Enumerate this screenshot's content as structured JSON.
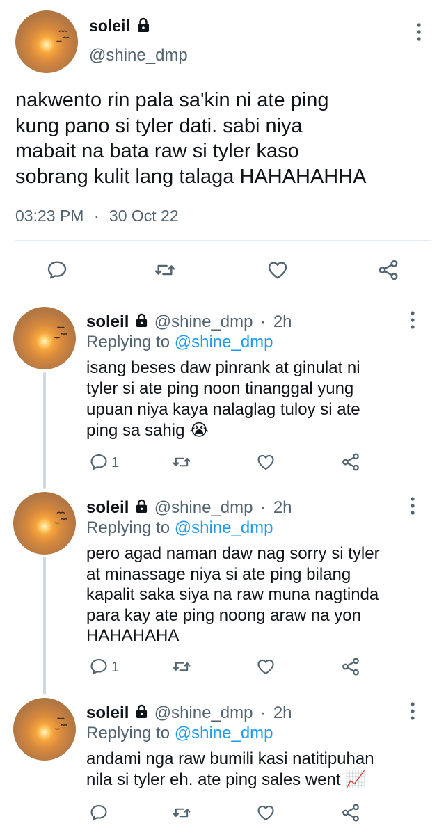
{
  "main_tweet": {
    "display_name": "soleil",
    "handle": "@shine_dmp",
    "text_lines": [
      "nakwento rin pala sa'kin ni ate ping",
      "kung pano si tyler dati. sabi niya",
      "mabait na bata raw si tyler kaso",
      "sobrang kulit lang talaga HAHAHAHHA"
    ],
    "time": "03:23 PM",
    "separator": "·",
    "date": "30 Oct 22"
  },
  "replies": [
    {
      "display_name": "soleil",
      "handle": "@shine_dmp",
      "dot": "·",
      "age": "2h",
      "replying_prefix": "Replying to",
      "replying_handle": "@shine_dmp",
      "text_lines": [
        "isang beses daw pinrank at ginulat ni",
        "tyler si ate ping noon tinanggal yung",
        "upuan niya kaya nalaglag tuloy si ate",
        "ping sa sahig 😭"
      ],
      "reply_count": "1"
    },
    {
      "display_name": "soleil",
      "handle": "@shine_dmp",
      "dot": "·",
      "age": "2h",
      "replying_prefix": "Replying to",
      "replying_handle": "@shine_dmp",
      "text_lines": [
        "pero agad naman daw nag sorry si tyler",
        "at minassage niya si ate ping bilang",
        "kapalit saka siya na raw muna nagtinda",
        "para kay ate ping noong araw na yon",
        "HAHAHAHA"
      ],
      "reply_count": "1"
    },
    {
      "display_name": "soleil",
      "handle": "@shine_dmp",
      "dot": "·",
      "age": "2h",
      "replying_prefix": "Replying to",
      "replying_handle": "@shine_dmp",
      "text_lines": [
        "andami nga raw bumili kasi natitipuhan",
        "nila si tyler eh. ate ping sales went 📈"
      ],
      "reply_count": ""
    }
  ],
  "icons": {
    "reply": "comment-icon",
    "retweet": "retweet-icon",
    "like": "heart-icon",
    "share": "share-icon",
    "more": "more-vertical-icon",
    "lock": "lock-icon"
  },
  "colors": {
    "text": "#0f1419",
    "secondary": "#536471",
    "link": "#1d9bf0",
    "divider": "#e6ecf0",
    "thread_line": "#cfd9de"
  }
}
